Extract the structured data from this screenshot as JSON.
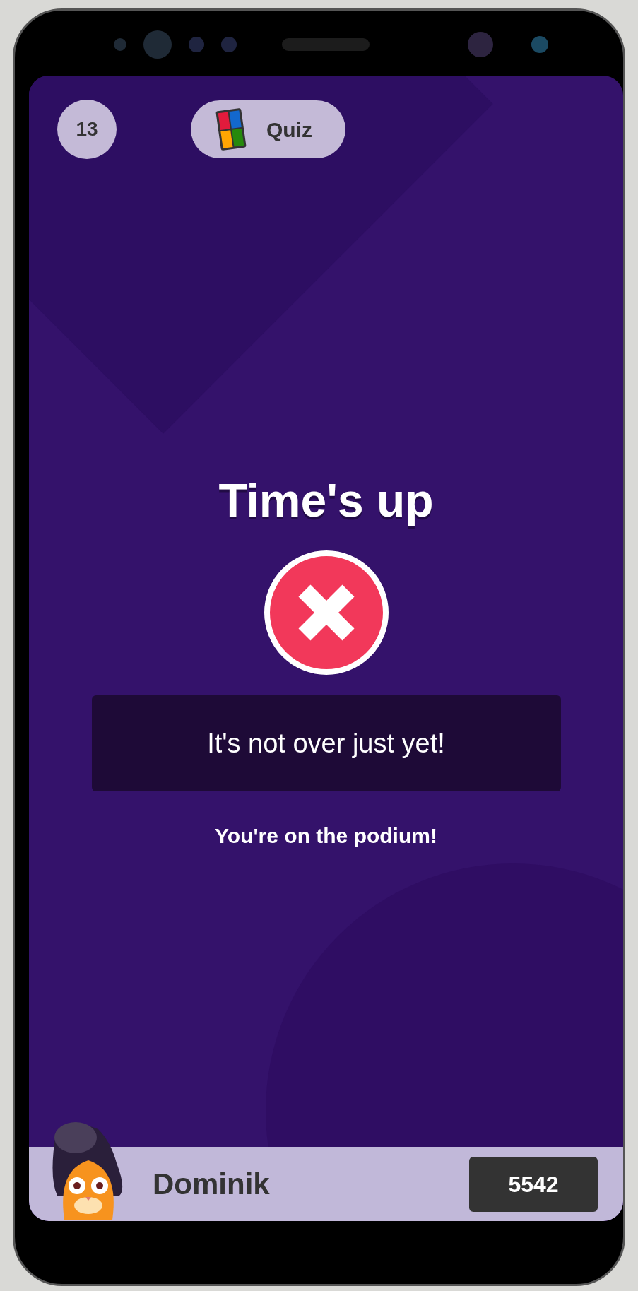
{
  "question_counter": "13",
  "game_mode": {
    "label": "Quiz"
  },
  "result": {
    "title": "Time's up",
    "correct": false
  },
  "message": "It's not over just yet!",
  "subtitle": "You're on the podium!",
  "player": {
    "name": "Dominik",
    "score": "5542"
  }
}
